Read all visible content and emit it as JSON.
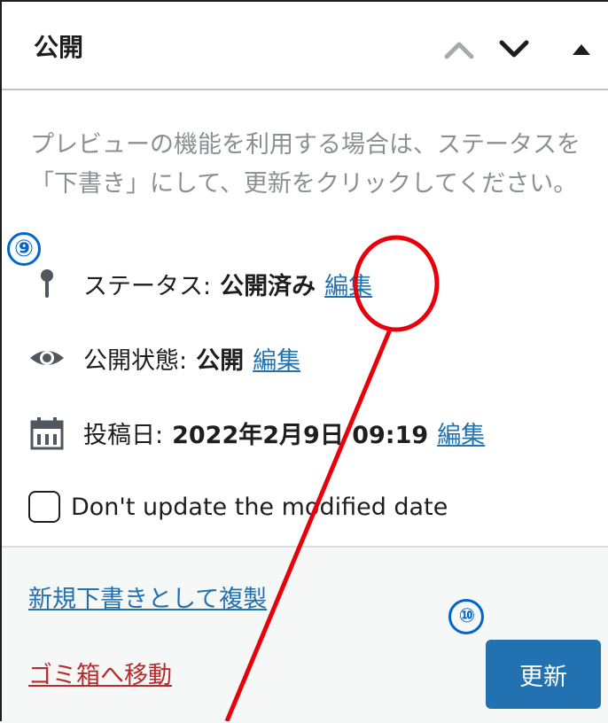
{
  "header": {
    "title": "公開",
    "move_up_icon": "chevron-up-icon",
    "move_down_icon": "chevron-down-icon",
    "toggle_icon": "triangle-up-icon"
  },
  "notice": "プレビューの機能を利用する場合は、ステータスを「下書き」にして、更新をクリックしてください。",
  "status": {
    "icon": "pin-icon",
    "label": "ステータス:",
    "value": "公開済み",
    "edit": "編集"
  },
  "visibility": {
    "icon": "eye-icon",
    "label": "公開状態:",
    "value": "公開",
    "edit": "編集"
  },
  "published": {
    "icon": "calendar-icon",
    "label": "投稿日:",
    "value": "2022年2月9日 09:19",
    "edit": "編集"
  },
  "modified_checkbox": {
    "label": "Don't update the modified date",
    "checked": false
  },
  "footer": {
    "duplicate_link": "新規下書きとして複製",
    "trash_link": "ゴミ箱へ移動",
    "update_button": "更新"
  },
  "annotations": {
    "badge_status": "⑨",
    "badge_update": "⑩"
  },
  "colors": {
    "link": "#2271b1",
    "danger": "#b32d2e",
    "primary_button": "#2271b1",
    "annotation_red": "#e8000b",
    "annotation_blue": "#0066cc",
    "muted_text": "#8c8f94"
  }
}
